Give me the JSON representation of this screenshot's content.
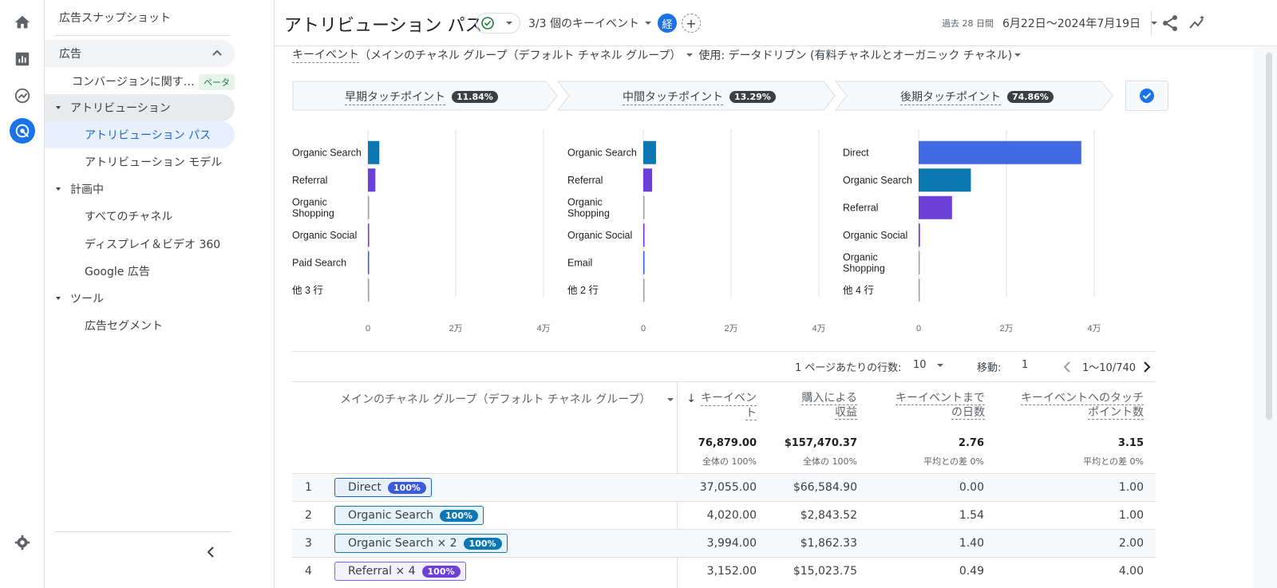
{
  "sidebar": {
    "title": "広告スナップショット",
    "section": "広告",
    "items": [
      {
        "label": "コンバージョンに関す…",
        "badge": "ベータ"
      },
      {
        "label": "アトリビューション"
      },
      {
        "label": "アトリビューション パス"
      },
      {
        "label": "アトリビューション モデル"
      },
      {
        "label": "計画中"
      },
      {
        "label": "すべてのチャネル"
      },
      {
        "label": "ディスプレイ＆ビデオ 360"
      },
      {
        "label": "Google 広告"
      },
      {
        "label": "ツール"
      },
      {
        "label": "広告セグメント"
      }
    ]
  },
  "header": {
    "title": "アトリビューション パス",
    "events": "3/3 個のキーイベント",
    "compare_badge": "経",
    "date_label": "過去 28 日間",
    "date_range": "6月22日～2024年7月19日"
  },
  "dimension": {
    "prefix": "キーイベント",
    "dim": "（メインのチャネル グループ（デフォルト チャネル グループ）",
    "model": "使用: データドリブン (有料チャネルとオーガニック チャネル)"
  },
  "touchpoints": [
    {
      "name": "早期タッチポイント",
      "pct": "11.84%"
    },
    {
      "name": "中間タッチポイント",
      "pct": "13.29%"
    },
    {
      "name": "後期タッチポイント",
      "pct": "74.86%"
    }
  ],
  "colors": {
    "accent": "#1a73e8",
    "direct": "#4169e1",
    "organic_search": "#0b78b4",
    "referral": "#6c3fd9",
    "social": "#7b2fd6",
    "paid": "#3b5bdb",
    "neutral": "#9aa0a6"
  },
  "chart_data": [
    {
      "type": "bar",
      "orientation": "horizontal",
      "categories": [
        "Organic Search",
        "Referral",
        "Organic Shopping",
        "Organic Social",
        "Paid Search",
        "他 3 行"
      ],
      "values": [
        2600,
        1700,
        80,
        120,
        100,
        60
      ],
      "xlim": [
        0,
        40000
      ],
      "xticks": [
        "0",
        "2万",
        "4万"
      ],
      "bar_colors": [
        "organic_search",
        "referral",
        "neutral",
        "social",
        "paid",
        "neutral"
      ]
    },
    {
      "type": "bar",
      "orientation": "horizontal",
      "categories": [
        "Organic Search",
        "Referral",
        "Organic Shopping",
        "Organic Social",
        "Email",
        "他 2 行"
      ],
      "values": [
        2900,
        2000,
        90,
        150,
        140,
        60
      ],
      "xlim": [
        0,
        40000
      ],
      "xticks": [
        "0",
        "2万",
        "4万"
      ],
      "bar_colors": [
        "organic_search",
        "referral",
        "neutral",
        "social",
        "paid",
        "neutral"
      ]
    },
    {
      "type": "bar",
      "orientation": "horizontal",
      "categories": [
        "Direct",
        "Organic Search",
        "Referral",
        "Organic Social",
        "Organic Shopping",
        "他 4 行"
      ],
      "values": [
        37055,
        11900,
        7600,
        300,
        120,
        80
      ],
      "xlim": [
        0,
        40000
      ],
      "xticks": [
        "0",
        "2万",
        "4万"
      ],
      "bar_colors": [
        "direct",
        "organic_search",
        "referral",
        "social",
        "neutral",
        "neutral"
      ]
    }
  ],
  "pager": {
    "rows_label": "1 ページあたりの行数:",
    "rows_value": "10",
    "goto_label": "移動:",
    "goto_value": "1",
    "range": "1～10/740"
  },
  "table": {
    "dim_header": "メインのチャネル グループ（デフォルト チャネル グループ）",
    "headers": [
      {
        "l1": "キーイベン",
        "l2": "ト"
      },
      {
        "l1": "購入による",
        "l2": "収益"
      },
      {
        "l1": "キーイベントまで",
        "l2": "の日数"
      },
      {
        "l1": "キーイベントへのタッチ",
        "l2": "ポイント数"
      }
    ],
    "totals": [
      {
        "value": "76,879.00",
        "sub": "全体の 100%"
      },
      {
        "value": "$157,470.37",
        "sub": "全体の 100%"
      },
      {
        "value": "2.76",
        "sub": "平均との差 0%"
      },
      {
        "value": "3.15",
        "sub": "平均との差 0%"
      }
    ],
    "rows": [
      {
        "idx": "1",
        "path": "Direct",
        "pct": "100%",
        "vals": [
          "37,055.00",
          "$66,584.90",
          "0.00",
          "1.00"
        ]
      },
      {
        "idx": "2",
        "path": "Organic Search",
        "pct": "100%",
        "vals": [
          "4,020.00",
          "$2,843.52",
          "1.54",
          "1.00"
        ]
      },
      {
        "idx": "3",
        "path": "Organic Search × 2",
        "pct": "100%",
        "vals": [
          "3,994.00",
          "$1,862.33",
          "1.40",
          "2.00"
        ]
      },
      {
        "idx": "4",
        "path": "Referral × 4",
        "pct": "100%",
        "vals": [
          "3,152.00",
          "$15,023.75",
          "0.49",
          "4.00"
        ]
      }
    ]
  }
}
